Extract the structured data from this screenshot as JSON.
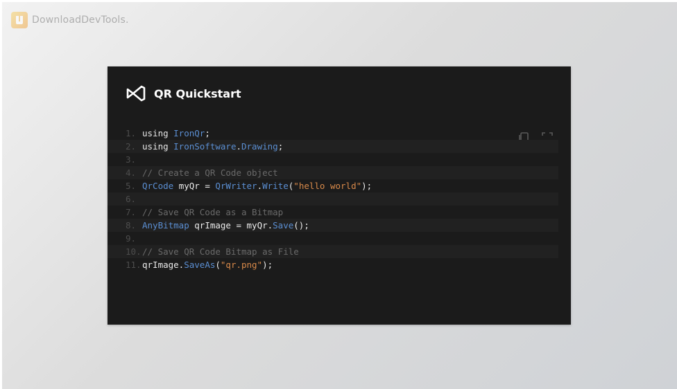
{
  "watermark": {
    "text": "DownloadDevTools."
  },
  "card": {
    "title": "QR Quickstart",
    "tools": {
      "copy_icon": "copy-icon",
      "fullscreen_icon": "fullscreen-icon"
    }
  },
  "code": {
    "lines": [
      {
        "num": "1.",
        "tokens": [
          {
            "t": "using ",
            "c": "kw"
          },
          {
            "t": "IronQr",
            "c": "type"
          },
          {
            "t": ";",
            "c": "plain"
          }
        ]
      },
      {
        "num": "2.",
        "tokens": [
          {
            "t": "using ",
            "c": "kw"
          },
          {
            "t": "IronSoftware",
            "c": "type"
          },
          {
            "t": ".",
            "c": "plain"
          },
          {
            "t": "Drawing",
            "c": "type"
          },
          {
            "t": ";",
            "c": "plain"
          }
        ]
      },
      {
        "num": "3.",
        "tokens": []
      },
      {
        "num": "4.",
        "tokens": [
          {
            "t": "// Create a QR Code object",
            "c": "cmt"
          }
        ]
      },
      {
        "num": "5.",
        "tokens": [
          {
            "t": "QrCode ",
            "c": "type"
          },
          {
            "t": "myQr = ",
            "c": "plain"
          },
          {
            "t": "QrWriter",
            "c": "type"
          },
          {
            "t": ".",
            "c": "plain"
          },
          {
            "t": "Write",
            "c": "method"
          },
          {
            "t": "(",
            "c": "plain"
          },
          {
            "t": "\"hello world\"",
            "c": "str"
          },
          {
            "t": ");",
            "c": "plain"
          }
        ]
      },
      {
        "num": "6.",
        "tokens": []
      },
      {
        "num": "7.",
        "tokens": [
          {
            "t": "// Save QR Code as a Bitmap",
            "c": "cmt"
          }
        ]
      },
      {
        "num": "8.",
        "tokens": [
          {
            "t": "AnyBitmap ",
            "c": "type"
          },
          {
            "t": "qrImage = myQr.",
            "c": "plain"
          },
          {
            "t": "Save",
            "c": "method"
          },
          {
            "t": "();",
            "c": "plain"
          }
        ]
      },
      {
        "num": "9.",
        "tokens": []
      },
      {
        "num": "10.",
        "tokens": [
          {
            "t": "// Save QR Code Bitmap as File",
            "c": "cmt"
          }
        ]
      },
      {
        "num": "11.",
        "tokens": [
          {
            "t": "qrImage.",
            "c": "plain"
          },
          {
            "t": "SaveAs",
            "c": "method"
          },
          {
            "t": "(",
            "c": "plain"
          },
          {
            "t": "\"qr.png\"",
            "c": "str"
          },
          {
            "t": ");",
            "c": "plain"
          }
        ]
      }
    ]
  },
  "colors": {
    "card_bg": "#1b1b1b",
    "type": "#5b8fd3",
    "string": "#d98a4a",
    "comment": "#6a6a6a"
  }
}
